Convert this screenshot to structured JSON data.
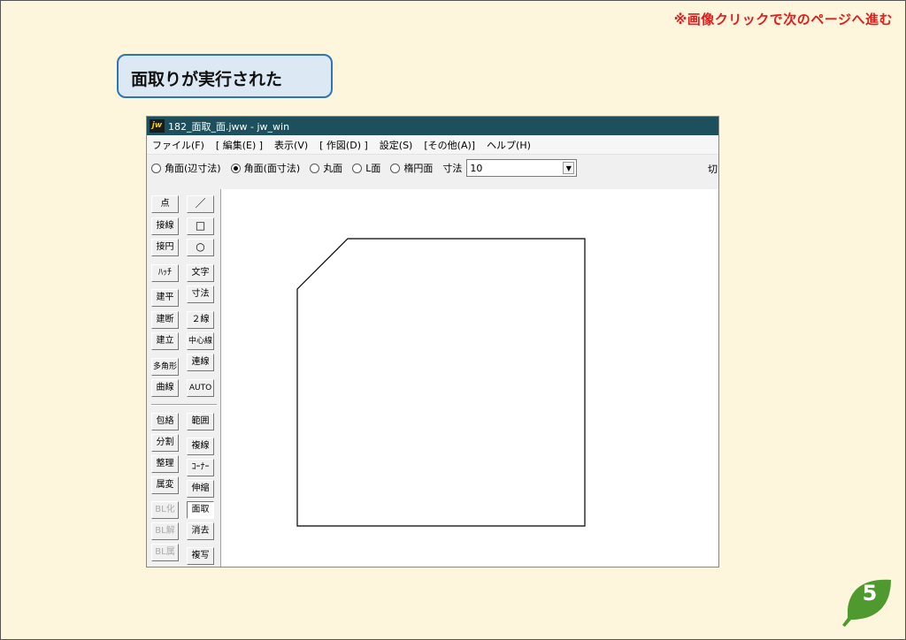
{
  "slide": {
    "note": "※画像クリックで次のページへ進む",
    "callout": "面取りが実行された",
    "page_number": "5",
    "colors": {
      "background": "#fdf5dc",
      "note": "#e21b1b",
      "callout_border": "#2e75b6",
      "badge": "#4e9a2e",
      "titlebar": "#1d4f5c"
    }
  },
  "window": {
    "icon": "jw",
    "title": "182_面取_面.jww - jw_win",
    "menu": [
      "ファイル(F)",
      "[ 編集(E) ]",
      "表示(V)",
      "[ 作図(D) ]",
      "設定(S)",
      "[その他(A)]",
      "ヘルプ(H)"
    ],
    "options": [
      {
        "label": "角面(辺寸法)",
        "selected": false
      },
      {
        "label": "角面(面寸法)",
        "selected": true
      },
      {
        "label": "丸面",
        "selected": false
      },
      {
        "label": "L面",
        "selected": false
      },
      {
        "label": "楕円面",
        "selected": false
      }
    ],
    "dimension_label": "寸法",
    "dimension_value": "10",
    "cut_label": "切",
    "tools_left": [
      "点",
      "接線",
      "接円",
      "ﾊｯﾁ",
      "建平",
      "建断",
      "建立",
      "多角形",
      "曲線",
      "包絡",
      "分割",
      "整理",
      "属変",
      "BL化",
      "BL解",
      "BL属"
    ],
    "tools_right": [
      "／",
      "□",
      "○",
      "文字",
      "寸法",
      "２線",
      "中心線",
      "連線",
      "AUTO",
      "範囲",
      "複線",
      "ｺｰﾅｰ",
      "伸縮",
      "面取",
      "消去",
      "複写"
    ],
    "active_tool": "面取"
  }
}
